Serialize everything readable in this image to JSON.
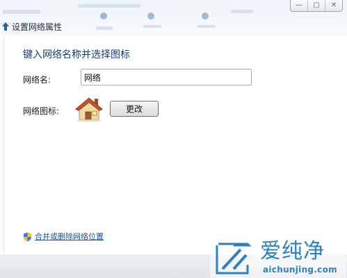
{
  "window": {
    "title": "设置网络属性",
    "buttons": {
      "minimize": "—",
      "maximize": "▢",
      "close": "✕"
    }
  },
  "dialog": {
    "heading": "键入网络名称并选择图标",
    "network_name": {
      "label": "网络名:",
      "value": "网络"
    },
    "network_icon": {
      "label": "网络图标:",
      "icon": "house-icon",
      "change_button": "更改"
    },
    "merge_link": {
      "icon": "shield-icon",
      "text": "合并或删除网络位置"
    }
  },
  "watermark": {
    "brand": "爱纯净",
    "url": "aichunjing.com"
  },
  "colors": {
    "heading": "#1b3c6e",
    "link": "#1a55a6",
    "watermark": "#2d7fc4"
  }
}
